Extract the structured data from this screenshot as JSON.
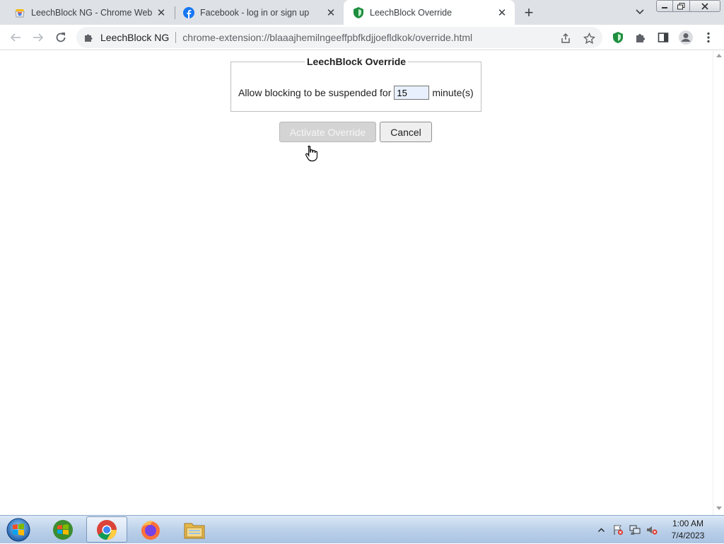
{
  "browser": {
    "tabs": [
      {
        "title": "LeechBlock NG - Chrome Web St",
        "favicon": "chrome-web-store-icon",
        "active": false
      },
      {
        "title": "Facebook - log in or sign up",
        "favicon": "facebook-icon",
        "active": false
      },
      {
        "title": "LeechBlock Override",
        "favicon": "leechblock-shield-icon",
        "active": true
      }
    ],
    "new_tab_label": "+",
    "omnibox": {
      "site_name": "LeechBlock NG",
      "url": "chrome-extension://blaaajhemilngeeffpbfkdjjoefldkok/override.html"
    }
  },
  "page": {
    "legend": "LeechBlock Override",
    "prompt": "Allow blocking to be suspended for",
    "minutes_value": "15",
    "unit": "minute(s)",
    "activate_label": "Activate Override",
    "cancel_label": "Cancel"
  },
  "taskbar": {
    "time": "1:00 AM",
    "date": "7/4/2023",
    "apps": [
      "chrome-icon",
      "firefox-icon",
      "file-explorer-icon"
    ]
  },
  "colors": {
    "tabstrip": "#dee1e6",
    "taskbar": "#bcd1ea",
    "facebook": "#1877f2",
    "leechblock": "#16a34a"
  }
}
